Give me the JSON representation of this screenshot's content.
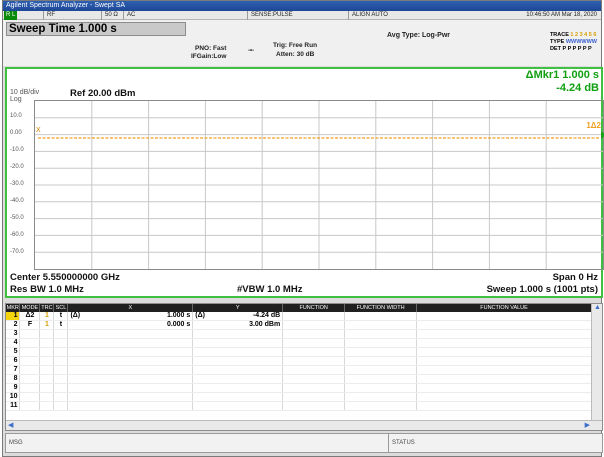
{
  "window": {
    "title": "Agilent Spectrum Analyzer - Swept SA"
  },
  "status": {
    "rl": "R L",
    "rf": "RF",
    "impedance": "50 Ω",
    "ac": "AC",
    "sense": "SENSE:PULSE",
    "align": "ALIGN AUTO",
    "datetime": "10:46:50 AM Mar 18, 2020"
  },
  "header": {
    "sweep_time": "Sweep Time 1.000 s",
    "pno": "PNO: Fast",
    "ifgain": "IFGain:Low",
    "trig": "Trig: Free Run",
    "atten": "Atten: 30 dB",
    "avg_type": "Avg Type: Log-Pwr",
    "trace_label": "TRACE",
    "trace_nums": "1 2 3 4 5 6",
    "type_label": "TYPE",
    "type_values": "WWWWWW",
    "det_label": "DET",
    "det_values": "P P P P P P"
  },
  "plot": {
    "scale": "10 dB/div",
    "log": "Log",
    "ref_level": "Ref 20.00 dBm",
    "marker_title": "ΔMkr1 1.000 s",
    "marker_value": "-4.24 dB",
    "marker_tag": "1Δ2",
    "marker_left": "X",
    "y_ticks": [
      "10.0",
      "0.00",
      "-10.0",
      "-20.0",
      "-30.0",
      "-40.0",
      "-50.0",
      "-60.0",
      "-70.0"
    ],
    "center": "Center 5.550000000 GHz",
    "span": "Span 0 Hz",
    "rbw": "Res BW 1.0 MHz",
    "vbw": "#VBW 1.0 MHz",
    "sweep": "Sweep  1.000 s (1001 pts)"
  },
  "marker_table": {
    "headers": [
      "MKR",
      "MODE",
      "TRC",
      "SCL",
      "X",
      "Y",
      "FUNCTION",
      "FUNCTION WIDTH",
      "FUNCTION VALUE"
    ],
    "rows": [
      {
        "num": "1",
        "mode": "Δ2",
        "trc": "1",
        "scl": "t",
        "x_prefix": "(Δ)",
        "x": "1.000 s",
        "y_prefix": "(Δ)",
        "y": "-4.24 dB"
      },
      {
        "num": "2",
        "mode": "F",
        "trc": "1",
        "scl": "t",
        "x_prefix": "",
        "x": "0.000 s",
        "y_prefix": "",
        "y": "3.00 dBm"
      },
      {
        "num": "3"
      },
      {
        "num": "4"
      },
      {
        "num": "5"
      },
      {
        "num": "6"
      },
      {
        "num": "7"
      },
      {
        "num": "8"
      },
      {
        "num": "9"
      },
      {
        "num": "10"
      },
      {
        "num": "11"
      }
    ]
  },
  "footer": {
    "msg": "MSG",
    "status": "STATUS"
  }
}
